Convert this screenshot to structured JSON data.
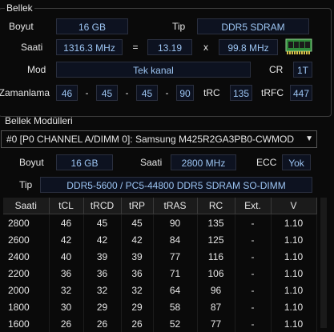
{
  "memory": {
    "title": "Bellek",
    "size_label": "Boyut",
    "size_value": "16 GB",
    "type_label": "Tip",
    "type_value": "DDR5 SDRAM",
    "clock_label": "Saati",
    "clock_value": "1316.3 MHz",
    "equals": "=",
    "multiplier": "13.19",
    "times": "x",
    "bus_value": "99.8 MHz",
    "mode_label": "Mod",
    "mode_value": "Tek kanal",
    "cr_label": "CR",
    "cr_value": "1T",
    "timings_label": "Zamanlama",
    "timing_values": [
      "46",
      "45",
      "45",
      "90"
    ],
    "dash": "-",
    "trc_label": "tRC",
    "trc_value": "135",
    "trfc_label": "tRFC",
    "trfc_value": "447"
  },
  "modules": {
    "title": "Bellek Modülleri",
    "selected_module": "#0 [P0 CHANNEL A/DIMM 0]: Samsung M425R2GA3PB0-CWMOD",
    "size_label": "Boyut",
    "size_value": "16 GB",
    "clock_label": "Saati",
    "clock_value": "2800 MHz",
    "ecc_label": "ECC",
    "ecc_value": "Yok",
    "type_label": "Tip",
    "type_value": "DDR5-5600 / PC5-44800 DDR5 SDRAM SO-DIMM",
    "table": {
      "headers": [
        "Saati",
        "tCL",
        "tRCD",
        "tRP",
        "tRAS",
        "RC",
        "Ext.",
        "V"
      ],
      "rows": [
        [
          "2800",
          "46",
          "45",
          "45",
          "90",
          "135",
          "-",
          "1.10"
        ],
        [
          "2600",
          "42",
          "42",
          "42",
          "84",
          "125",
          "-",
          "1.10"
        ],
        [
          "2400",
          "40",
          "39",
          "39",
          "77",
          "116",
          "-",
          "1.10"
        ],
        [
          "2200",
          "36",
          "36",
          "36",
          "71",
          "106",
          "-",
          "1.10"
        ],
        [
          "2000",
          "32",
          "32",
          "32",
          "64",
          "96",
          "-",
          "1.10"
        ],
        [
          "1800",
          "30",
          "29",
          "29",
          "58",
          "87",
          "-",
          "1.10"
        ],
        [
          "1600",
          "26",
          "26",
          "26",
          "52",
          "77",
          "-",
          "1.10"
        ]
      ]
    }
  }
}
